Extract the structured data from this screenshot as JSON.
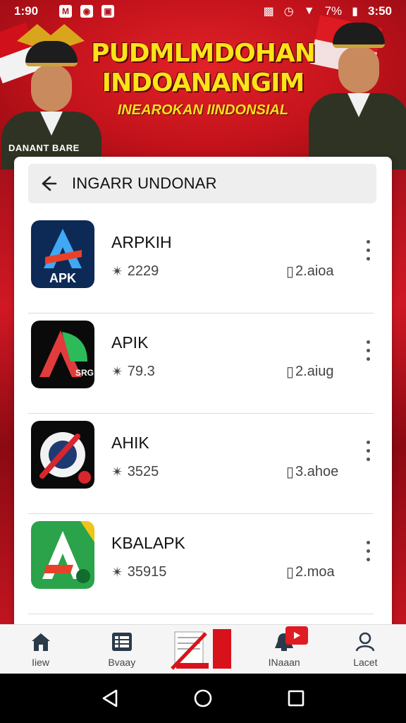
{
  "status_bar": {
    "time": "1:90",
    "battery": "7%",
    "clock_right": "3:50"
  },
  "banner": {
    "title_line1": "PUDMLMDOHAN",
    "title_line2": "INDOANANGIM",
    "subtitle": "INEAROKAN IINDONSIAL",
    "soldier_caption": "DANANT BARE"
  },
  "search": {
    "title": "INGARR UNDONAR"
  },
  "apps": [
    {
      "name": "ARPKIH",
      "rating": "2229",
      "size": "2.aioa",
      "icon": "apk-blue-icon"
    },
    {
      "name": "APIK",
      "rating": "79.3",
      "size": "2.aiug",
      "icon": "apk-green-black-icon"
    },
    {
      "name": "AHIK",
      "rating": "3525",
      "size": "3.ahoe",
      "icon": "apk-round-icon"
    },
    {
      "name": "KBALAPK",
      "rating": "35915",
      "size": "2.moa",
      "icon": "apk-green-gold-icon"
    }
  ],
  "bottom_nav": [
    {
      "label": "Iiew",
      "icon": "home-icon"
    },
    {
      "label": "Bvaay",
      "icon": "list-icon"
    },
    {
      "label": "",
      "icon": "promo-icon"
    },
    {
      "label": "INaaan",
      "icon": "bell-icon"
    },
    {
      "label": "Lacet",
      "icon": "user-icon"
    }
  ],
  "colors": {
    "brand_red": "#b5121b",
    "title_yellow": "#ffe21a"
  }
}
